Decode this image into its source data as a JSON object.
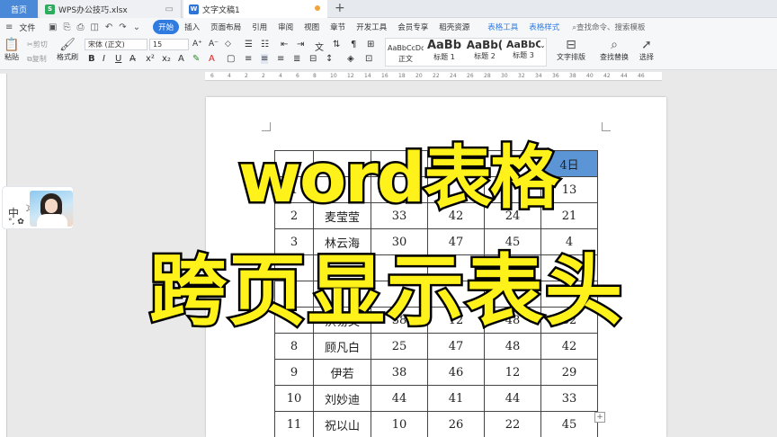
{
  "tabs": [
    {
      "label": "首页"
    },
    {
      "label": "WPS办公技巧.xlsx",
      "icon": "S"
    },
    {
      "label": "文字文稿1",
      "icon": "W"
    }
  ],
  "menu": {
    "file_label": "文件",
    "items": [
      "开始",
      "插入",
      "页面布局",
      "引用",
      "审阅",
      "视图",
      "章节",
      "开发工具",
      "会员专享",
      "稻壳资源"
    ],
    "table_tools": [
      "表格工具",
      "表格样式"
    ],
    "search_placeholder": "查找命令、搜索模板"
  },
  "ribbon": {
    "paste": "粘贴",
    "cut": "剪切",
    "copy": "复制",
    "format_painter": "格式刷",
    "font_name": "宋体 (正文)",
    "font_size": "15",
    "styles": [
      {
        "sample": "AaBbCcDd",
        "name": "正文"
      },
      {
        "sample": "AaBb",
        "name": "标题 1"
      },
      {
        "sample": "AaBb(",
        "name": "标题 2"
      },
      {
        "sample": "AaBbC",
        "name": "标题 3"
      }
    ],
    "text_layout": "文字排版",
    "find_replace": "查找替换",
    "select": "选择"
  },
  "ruler_ticks": [
    "6",
    "4",
    "2",
    "2",
    "4",
    "6",
    "8",
    "10",
    "12",
    "14",
    "16",
    "18",
    "20",
    "22",
    "24",
    "26",
    "28",
    "30",
    "32",
    "34",
    "36",
    "38",
    "40",
    "42",
    "44",
    "46"
  ],
  "avatar": {
    "zh": "中",
    "moon": "☽",
    "sym": "°, ✿"
  },
  "table": {
    "header_last": "4日",
    "rows": [
      [
        "",
        "",
        "",
        "",
        "",
        "4日"
      ],
      [
        "1",
        "",
        "",
        "",
        "",
        "13"
      ],
      [
        "2",
        "麦莹莹",
        "33",
        "42",
        "24",
        "21"
      ],
      [
        "3",
        "林云海",
        "30",
        "47",
        "45",
        "4"
      ],
      [
        "",
        "",
        "",
        "",
        "",
        ""
      ],
      [
        "",
        "",
        "",
        "",
        "",
        ""
      ],
      [
        "7",
        "洪易文",
        "38",
        "12",
        "48",
        "32"
      ],
      [
        "8",
        "顾凡白",
        "25",
        "47",
        "48",
        "42"
      ],
      [
        "9",
        "伊若",
        "38",
        "46",
        "12",
        "29"
      ],
      [
        "10",
        "刘妙迪",
        "44",
        "41",
        "44",
        "33"
      ],
      [
        "11",
        "祝以山",
        "10",
        "26",
        "22",
        "45"
      ]
    ]
  },
  "overlay": {
    "line1": "word表格",
    "line2": "跨页显示表头"
  }
}
